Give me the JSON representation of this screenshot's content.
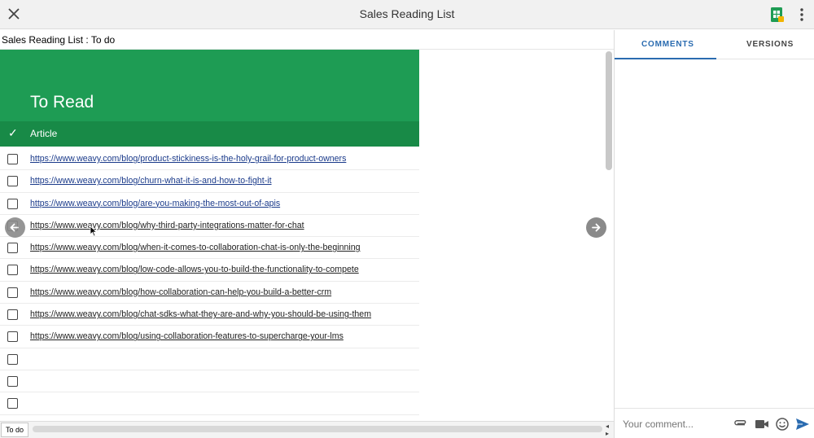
{
  "window": {
    "title": "Sales Reading List"
  },
  "breadcrumb": "Sales Reading List : To do",
  "sheet": {
    "heading": "To Read",
    "header": {
      "check_symbol": "✓",
      "column": "Article"
    },
    "rows": [
      {
        "url": "https://www.weavy.com/blog/product-stickiness-is-the-holy-grail-for-product-owners",
        "checked": false
      },
      {
        "url": "https://www.weavy.com/blog/churn-what-it-is-and-how-to-fight-it",
        "checked": false
      },
      {
        "url": "https://www.weavy.com/blog/are-you-making-the-most-out-of-apis",
        "checked": false
      },
      {
        "url": "https://www.weavy.com/blog/why-third-party-integrations-matter-for-chat",
        "checked": false
      },
      {
        "url": "https://www.weavy.com/blog/when-it-comes-to-collaboration-chat-is-only-the-beginning",
        "checked": false
      },
      {
        "url": "https://www.weavy.com/blog/low-code-allows-you-to-build-the-functionality-to-compete",
        "checked": false
      },
      {
        "url": "https://www.weavy.com/blog/how-collaboration-can-help-you-build-a-better-crm",
        "checked": false
      },
      {
        "url": "https://www.weavy.com/blog/chat-sdks-what-they-are-and-why-you-should-be-using-them",
        "checked": false
      },
      {
        "url": "https://www.weavy.com/blog/using-collaboration-features-to-supercharge-your-lms",
        "checked": false
      },
      {
        "url": "",
        "checked": false
      },
      {
        "url": "",
        "checked": false
      },
      {
        "url": "",
        "checked": false
      }
    ],
    "tab_label": "To do"
  },
  "panel": {
    "tabs": [
      "COMMENTS",
      "VERSIONS"
    ],
    "active_tab": "COMMENTS",
    "comment_placeholder": "Your comment..."
  },
  "colors": {
    "hero": "#1e9c54",
    "header_row": "#188a47",
    "accent": "#2a6bb0",
    "link": "#1a3a8a"
  },
  "icons": [
    "close-icon",
    "google-sheets-icon",
    "more-vert-icon",
    "arrow-left-icon",
    "arrow-right-icon",
    "attach-icon",
    "video-icon",
    "emoji-icon",
    "send-icon"
  ]
}
